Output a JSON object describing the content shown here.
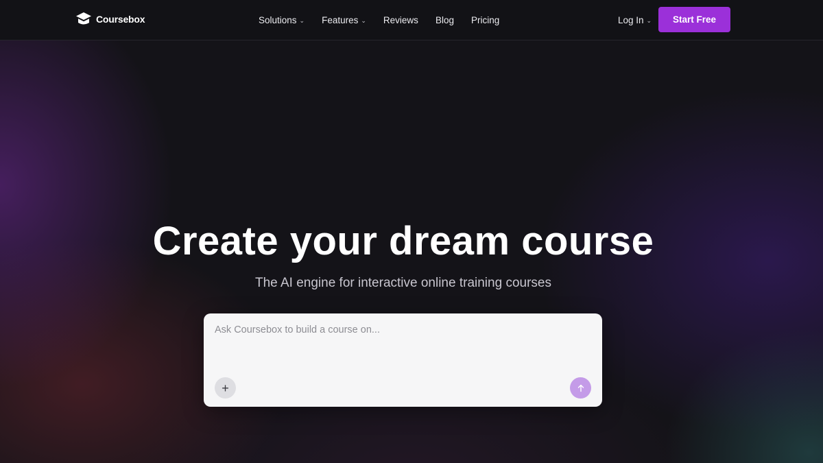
{
  "header": {
    "brand": "Coursebox",
    "nav": [
      {
        "label": "Solutions",
        "dropdown": true
      },
      {
        "label": "Features",
        "dropdown": true
      },
      {
        "label": "Reviews",
        "dropdown": false
      },
      {
        "label": "Blog",
        "dropdown": false
      },
      {
        "label": "Pricing",
        "dropdown": false
      }
    ],
    "login_label": "Log In",
    "cta_label": "Start Free"
  },
  "hero": {
    "title": "Create your dream course",
    "subtitle": "The AI engine for interactive online training courses",
    "prompt_placeholder": "Ask Coursebox to build a course on...",
    "add_icon": "plus-icon",
    "send_icon": "arrow-up-icon"
  },
  "colors": {
    "accent": "#9b30d9",
    "send_button": "#c49be8",
    "background": "#141318"
  }
}
